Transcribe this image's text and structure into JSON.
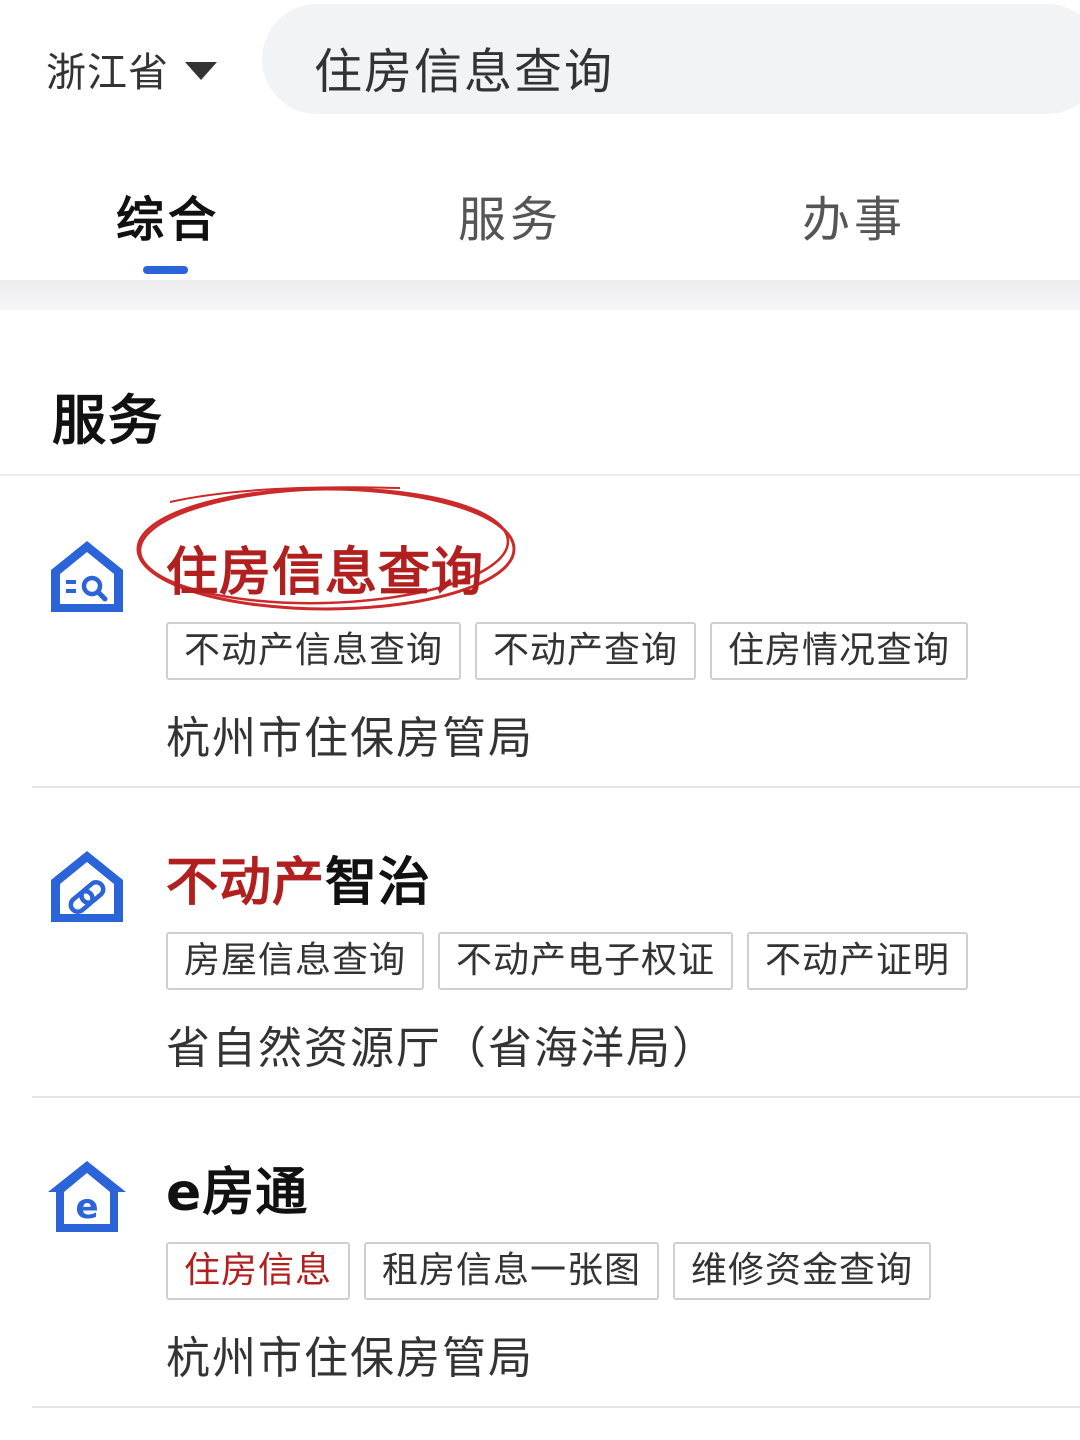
{
  "header": {
    "region": "浙江省",
    "search_value": "住房信息查询"
  },
  "tabs": [
    {
      "label": "综合",
      "active": true
    },
    {
      "label": "服务",
      "active": false
    },
    {
      "label": "办事",
      "active": false
    }
  ],
  "section": {
    "title": "服务"
  },
  "services": [
    {
      "icon": "house-search-icon",
      "title_red": "住房信息查询",
      "title_rest": "",
      "tags": [
        "不动产信息查询",
        "不动产查询",
        "住房情况查询"
      ],
      "org": "杭州市住保房管局"
    },
    {
      "icon": "house-link-icon",
      "title_red": "不动产",
      "title_rest": "智治",
      "tags": [
        "房屋信息查询",
        "不动产电子权证",
        "不动产证明"
      ],
      "org": "省自然资源厅（省海洋局）"
    },
    {
      "icon": "house-e-icon",
      "title_red": "",
      "title_rest": "e房通",
      "tags": [
        "住房信息",
        "租房信息一张图",
        "维修资金查询"
      ],
      "org": "杭州市住保房管局"
    }
  ],
  "colors": {
    "accent": "#2b63d9",
    "highlight": "#b1201f",
    "ring": "#cc2a2a"
  }
}
